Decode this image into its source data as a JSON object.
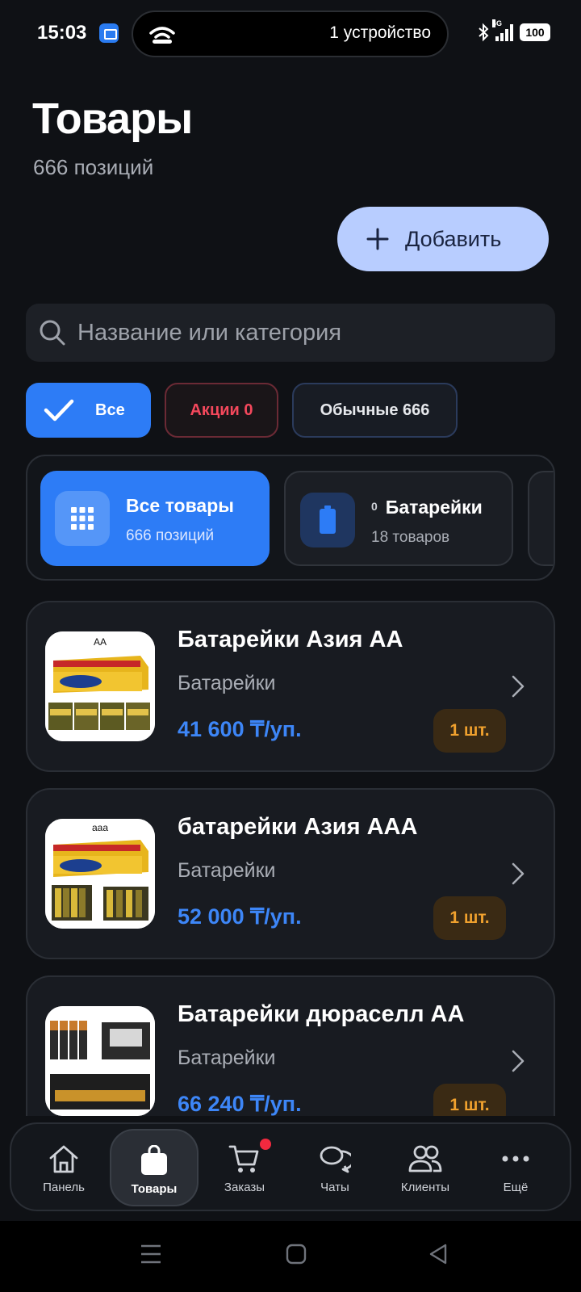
{
  "status_bar": {
    "time": "15:03",
    "hotspot_text": "1 устройство",
    "network": "4G",
    "battery": "100"
  },
  "header": {
    "title": "Товары",
    "subtitle": "666 позиций",
    "add_label": "Добавить"
  },
  "search": {
    "placeholder": "Название или категория"
  },
  "filters": [
    {
      "label": "Все",
      "selected": true
    },
    {
      "label": "Акции 0",
      "color": "#f4485c"
    },
    {
      "label": "Обычные 666"
    }
  ],
  "categories": [
    {
      "title": "Все товары",
      "subtitle": "666 позиций",
      "icon": "grid-icon",
      "selected": true
    },
    {
      "prefix": "0",
      "title": "Батарейки",
      "subtitle": "18 товаров",
      "icon": "battery-icon"
    }
  ],
  "products": [
    {
      "name": "Батарейки Азия АА",
      "category": "Батарейки",
      "price": "41 600 ₸/уп.",
      "qty": "1 шт.",
      "image_label": "AA"
    },
    {
      "name": "батарейки Азия ААА",
      "category": "Батарейки",
      "price": "52 000 ₸/уп.",
      "qty": "1 шт.",
      "image_label": "aaa"
    },
    {
      "name": "Батарейки дюраселл АА",
      "category": "Батарейки",
      "price": "66 240 ₸/уп.",
      "qty": "1 шт."
    }
  ],
  "bottom_nav": [
    {
      "label": "Панель",
      "icon": "home-icon"
    },
    {
      "label": "Товары",
      "icon": "bag-icon",
      "active": true
    },
    {
      "label": "Заказы",
      "icon": "cart-icon",
      "badge": true
    },
    {
      "label": "Чаты",
      "icon": "chat-icon"
    },
    {
      "label": "Клиенты",
      "icon": "users-icon"
    },
    {
      "label": "Ещё",
      "icon": "more-icon"
    }
  ],
  "colors": {
    "background": "#0f1115",
    "accent": "#2d7cf6",
    "price": "#3d86f7",
    "promo": "#f4485c",
    "qty": "#f0a12e"
  }
}
